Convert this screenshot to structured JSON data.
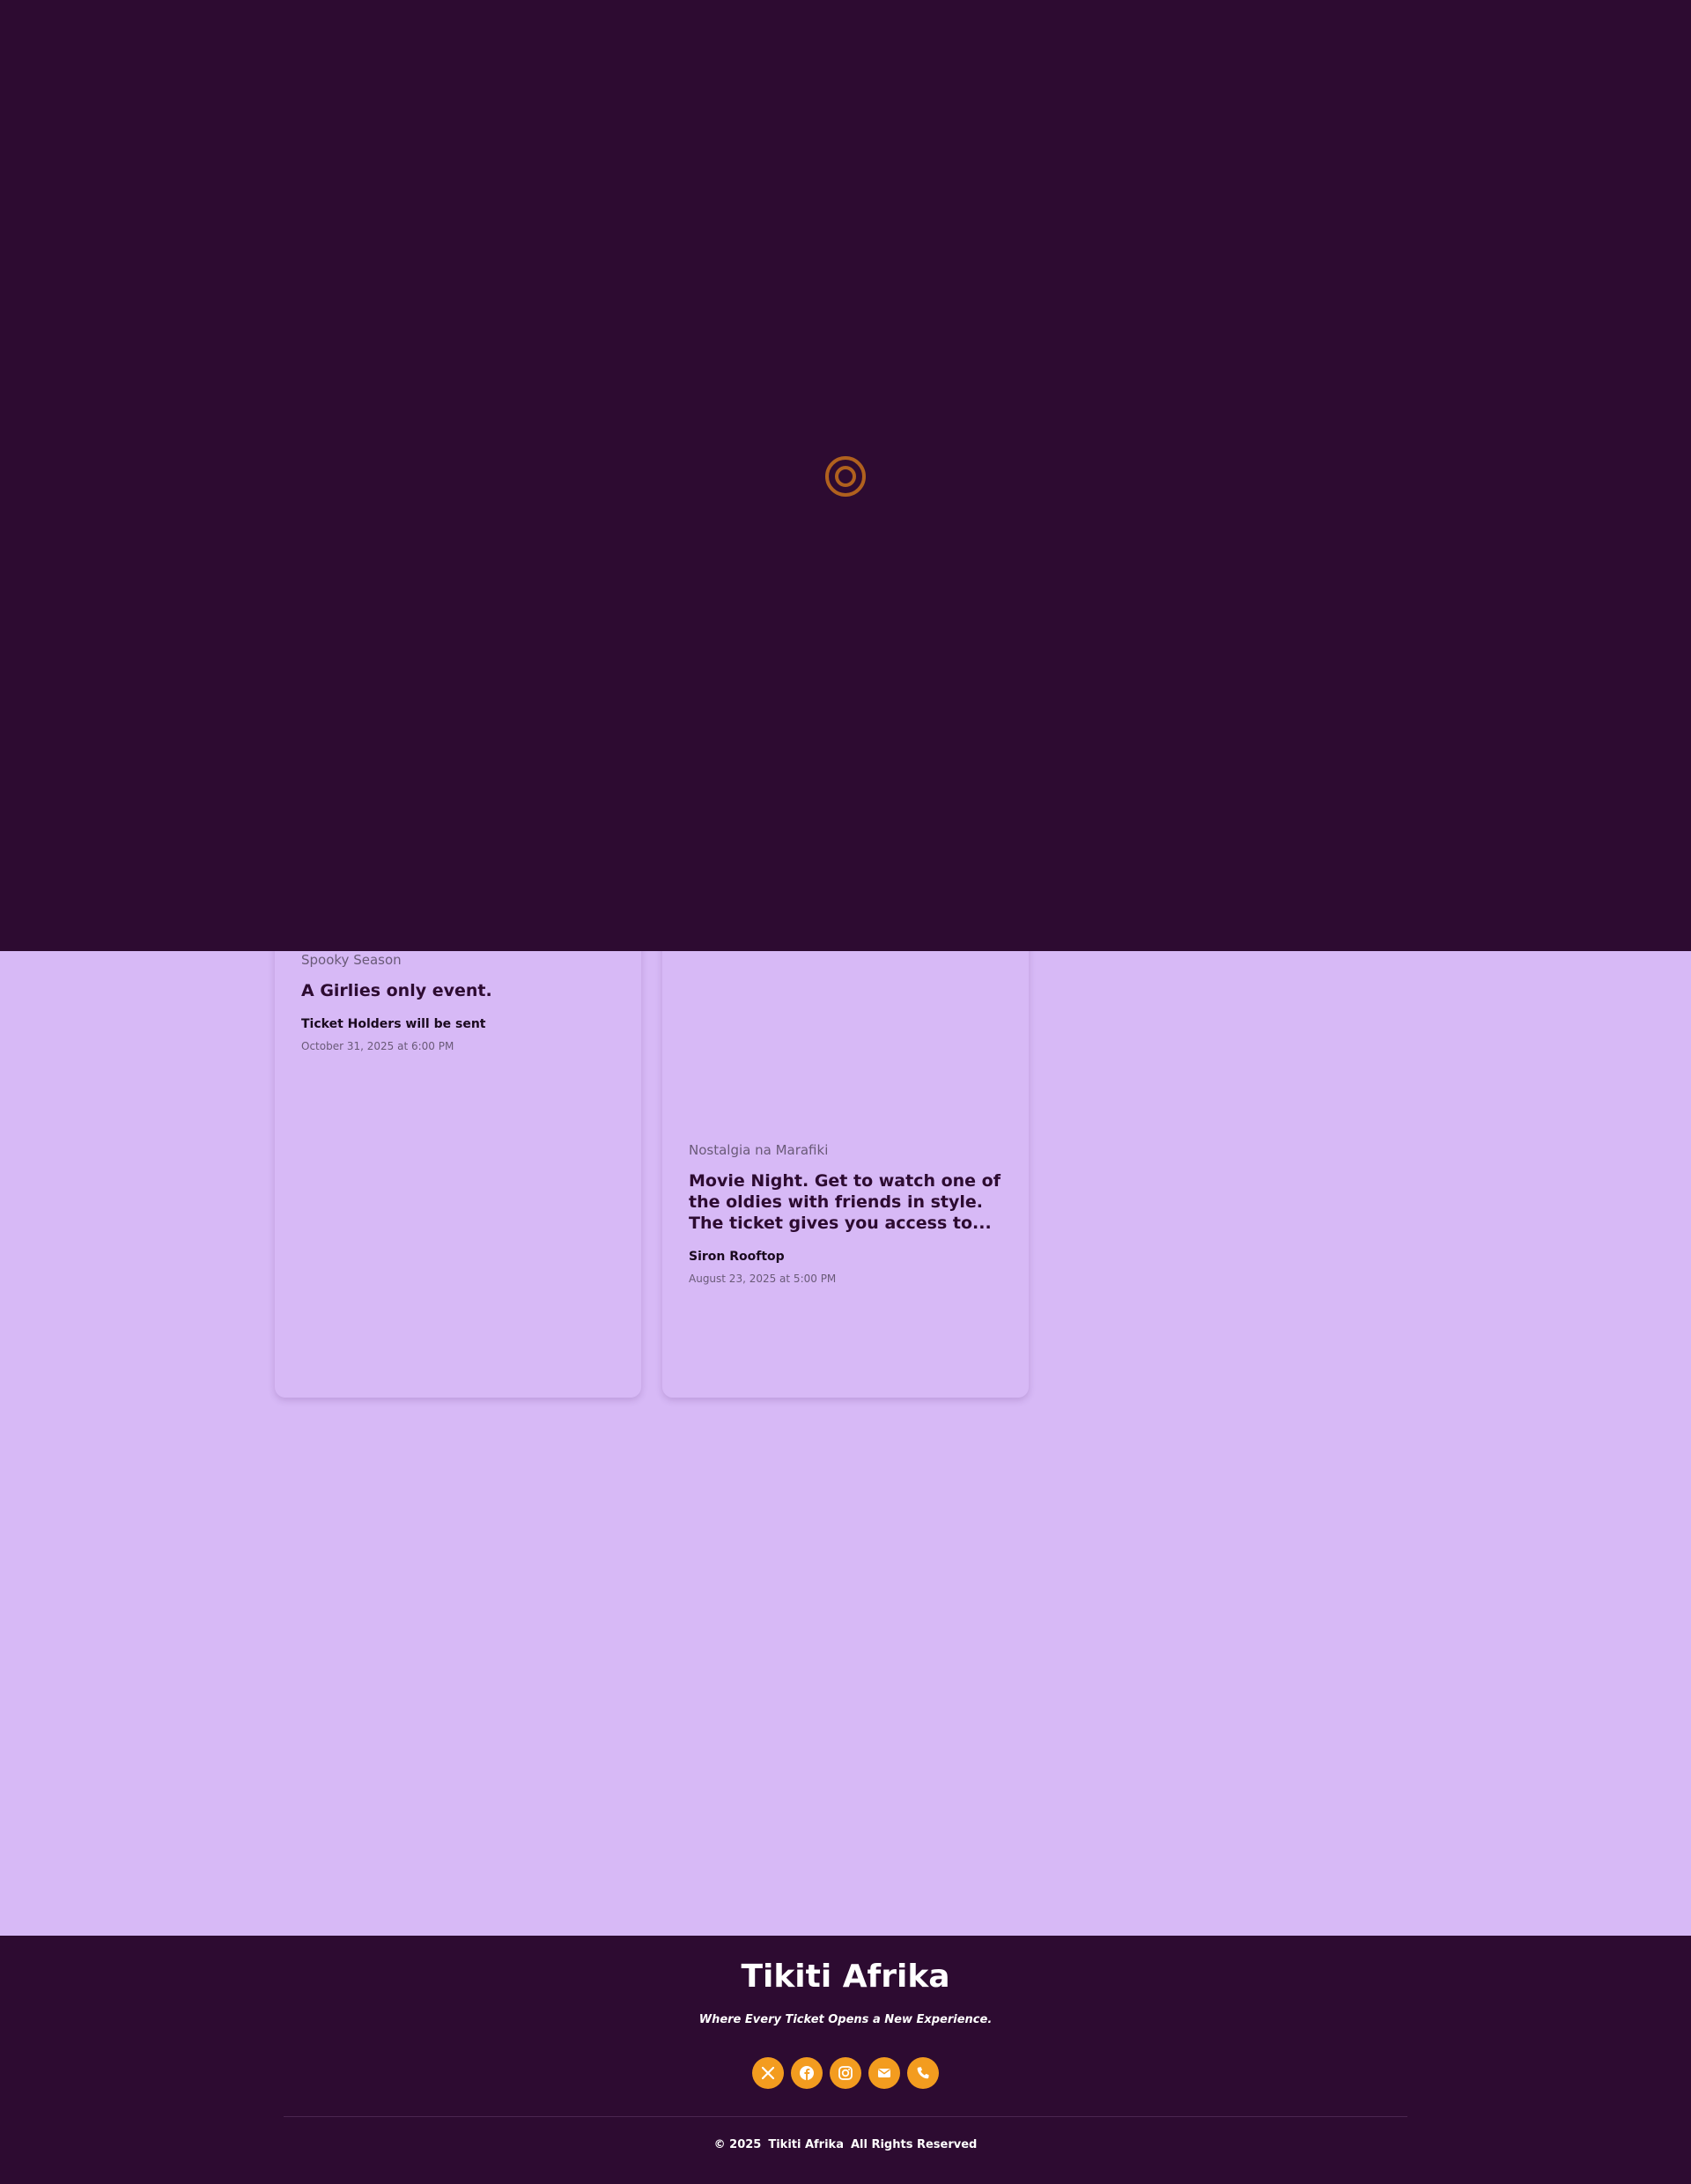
{
  "events": [
    {
      "category": "Spooky Season",
      "title": "A Girlies only event.",
      "venue": "Ticket Holders will be sent",
      "datetime": "October 31, 2025 at 6:00 PM"
    },
    {
      "category": "Nostalgia na Marafiki",
      "title": "Movie Night. Get to watch one of the oldies with friends in style. The ticket gives you access to...",
      "venue": "Siron Rooftop",
      "datetime": "August 23, 2025 at 5:00 PM"
    }
  ],
  "loading": {
    "spinner_icon": "loading-spinner-icon",
    "colors": {
      "background": "#2d0b31",
      "spinner": "#b0611e"
    }
  },
  "footer": {
    "brand": "Tikiti Afrika",
    "tagline": "Where Every Ticket Opens a New Experience.",
    "social": [
      {
        "name": "x",
        "icon": "x-icon"
      },
      {
        "name": "facebook",
        "icon": "facebook-icon"
      },
      {
        "name": "instagram",
        "icon": "instagram-icon"
      },
      {
        "name": "email",
        "icon": "mail-icon"
      },
      {
        "name": "phone",
        "icon": "phone-icon"
      }
    ],
    "copyright_prefix": "© 2025",
    "copyright_brand": "Tikiti Afrika",
    "copyright_suffix": "All Rights Reserved"
  },
  "colors": {
    "page_background": "#d7b9f6",
    "footer_background": "#2d0b31",
    "accent": "#f39c1f",
    "title_text": "#2d0b31"
  }
}
